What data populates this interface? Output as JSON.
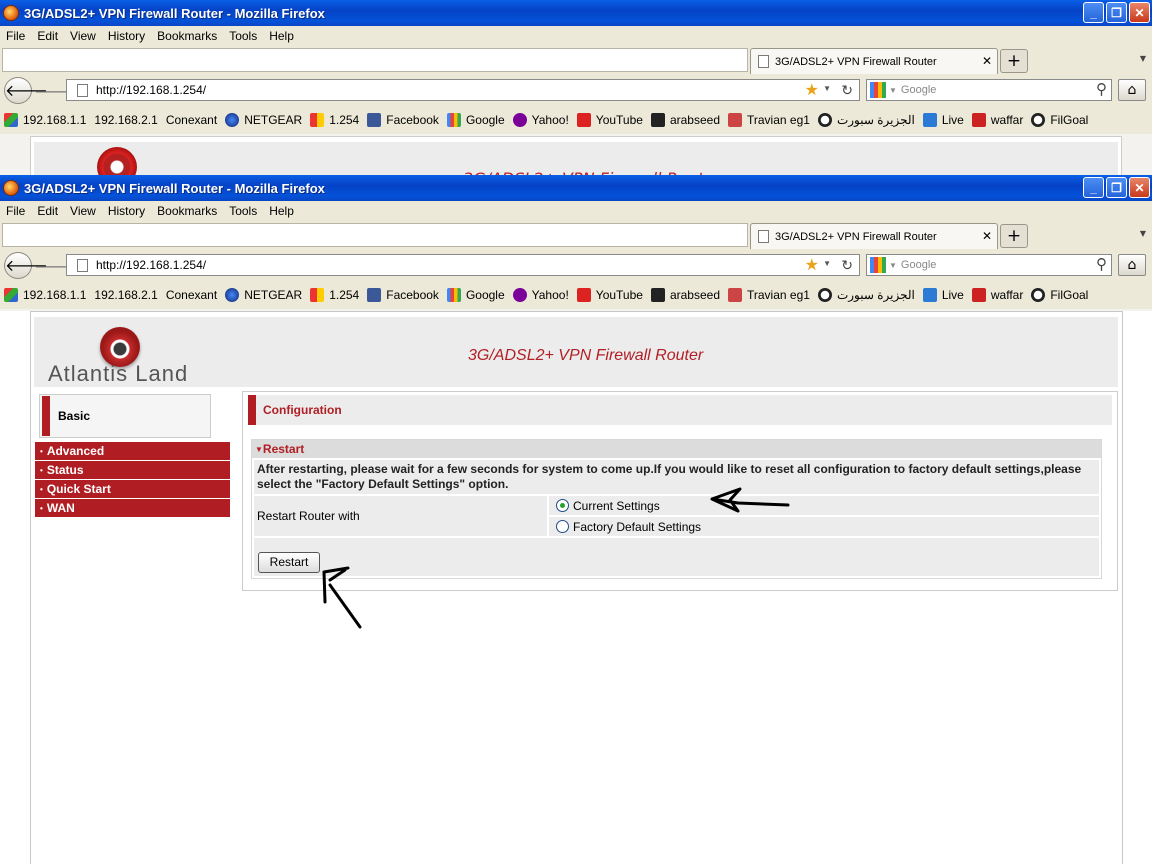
{
  "browser": {
    "title": "3G/ADSL2+ VPN Firewall Router - Mozilla Firefox",
    "menu": [
      "File",
      "Edit",
      "View",
      "History",
      "Bookmarks",
      "Tools",
      "Help"
    ],
    "tab_title": "3G/ADSL2+ VPN Firewall Router",
    "url": "http://192.168.1.254/",
    "search_placeholder": "Google",
    "bookmarks": [
      "192.168.1.1",
      "192.168.2.1",
      "Conexant",
      "NETGEAR",
      "1.254",
      "Facebook",
      "Google",
      "Yahoo!",
      "YouTube",
      "arabseed",
      "Travian eg1",
      "الجزيرة سبورت",
      "Live",
      "waffar",
      "FilGoal"
    ]
  },
  "ghost_banner_title": "3G/ADSL2+ VPN Firewall Router",
  "router": {
    "brand": "Atlantis Land",
    "banner_title": "3G/ADSL2+ VPN Firewall Router",
    "sidebar": {
      "current": "Basic",
      "items": [
        "Advanced",
        "Status",
        "Quick Start",
        "WAN"
      ]
    },
    "section_title": "Configuration",
    "restart": {
      "heading": "Restart",
      "description": "After restarting, please wait for a few seconds for system to come up.If you would like to reset all configuration to factory default settings,please select the \"Factory Default Settings\" option.",
      "label": "Restart Router with",
      "options": [
        "Current Settings",
        "Factory Default Settings"
      ],
      "selected": "Current Settings",
      "button": "Restart"
    }
  },
  "colors": {
    "accent": "#b01e23",
    "titlebar": "#0542c6"
  }
}
